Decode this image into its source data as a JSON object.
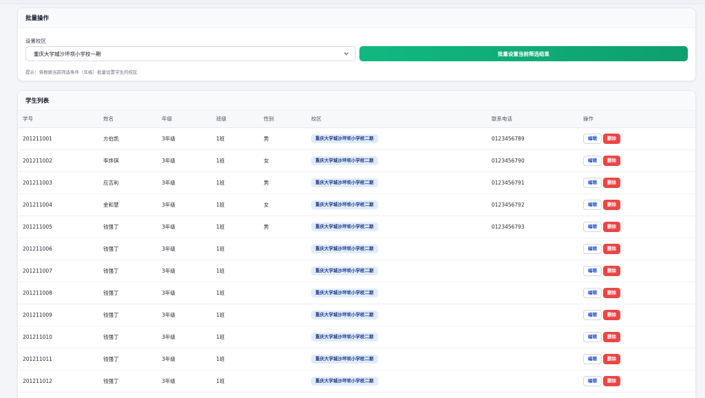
{
  "batch": {
    "title": "批量操作",
    "campus_label": "设置校区",
    "campus_selected": "重庆大学城沙坪坝小学校一期",
    "apply_button": "批量设置当前筛选结果",
    "hint": "提示：将根据当前筛选条件（年级）批量设置学生的校区"
  },
  "list": {
    "title": "学生列表",
    "columns": [
      "学号",
      "姓名",
      "年级",
      "班级",
      "性别",
      "校区",
      "联系电话",
      "操作"
    ],
    "edit_label": "编辑",
    "delete_label": "删除",
    "rows": [
      {
        "id": "201211001",
        "name": "方伯凯",
        "grade": "3年级",
        "class": "1班",
        "gender": "男",
        "campus": "重庆大学城沙坪坝小学校二期",
        "phone": "0123456789"
      },
      {
        "id": "201211002",
        "name": "李烨琪",
        "grade": "3年级",
        "class": "1班",
        "gender": "女",
        "campus": "重庆大学城沙坪坝小学校二期",
        "phone": "0123456790"
      },
      {
        "id": "201211003",
        "name": "应吉利",
        "grade": "3年级",
        "class": "1班",
        "gender": "男",
        "campus": "重庆大学城沙坪坝小学校二期",
        "phone": "0123456791"
      },
      {
        "id": "201211004",
        "name": "金和慧",
        "grade": "3年级",
        "class": "1班",
        "gender": "女",
        "campus": "重庆大学城沙坪坝小学校二期",
        "phone": "0123456792"
      },
      {
        "id": "201211005",
        "name": "钱强丁",
        "grade": "3年级",
        "class": "1班",
        "gender": "男",
        "campus": "重庆大学城沙坪坝小学校二期",
        "phone": "0123456793"
      },
      {
        "id": "201211006",
        "name": "钱强丁",
        "grade": "3年级",
        "class": "1班",
        "gender": "",
        "campus": "重庆大学城沙坪坝小学校二期",
        "phone": ""
      },
      {
        "id": "201211007",
        "name": "钱强丁",
        "grade": "3年级",
        "class": "1班",
        "gender": "",
        "campus": "重庆大学城沙坪坝小学校二期",
        "phone": ""
      },
      {
        "id": "201211008",
        "name": "钱强丁",
        "grade": "3年级",
        "class": "1班",
        "gender": "",
        "campus": "重庆大学城沙坪坝小学校二期",
        "phone": ""
      },
      {
        "id": "201211009",
        "name": "钱强丁",
        "grade": "3年级",
        "class": "1班",
        "gender": "",
        "campus": "重庆大学城沙坪坝小学校二期",
        "phone": ""
      },
      {
        "id": "201211010",
        "name": "钱强丁",
        "grade": "3年级",
        "class": "1班",
        "gender": "",
        "campus": "重庆大学城沙坪坝小学校二期",
        "phone": ""
      },
      {
        "id": "201211011",
        "name": "钱强丁",
        "grade": "3年级",
        "class": "1班",
        "gender": "",
        "campus": "重庆大学城沙坪坝小学校二期",
        "phone": ""
      },
      {
        "id": "201211012",
        "name": "钱强丁",
        "grade": "3年级",
        "class": "1班",
        "gender": "",
        "campus": "重庆大学城沙坪坝小学校二期",
        "phone": ""
      }
    ]
  }
}
